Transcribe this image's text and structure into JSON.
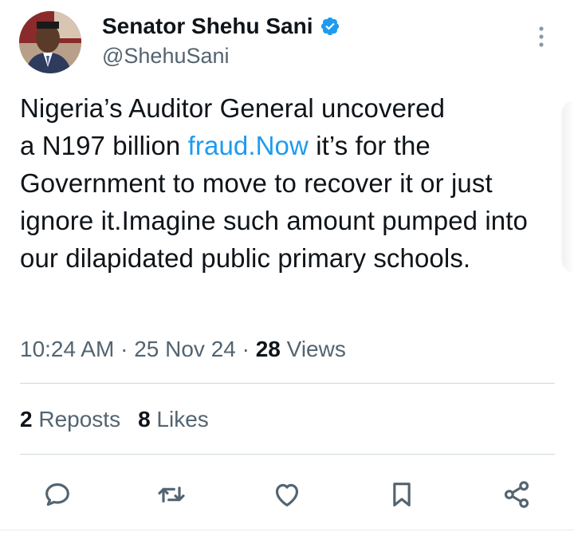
{
  "author": {
    "display_name": "Senator Shehu Sani",
    "handle": "@ShehuSani",
    "verified": true
  },
  "tweet": {
    "text_line1": "Nigeria’s Auditor General uncovered",
    "text_line2_pre": "a N197 billion ",
    "text_link": "fraud.Now",
    "text_line2_post": " it’s for the",
    "text_rest": "Government to move to recover it or just ignore it.Imagine such amount pumped into our dilapidated public primary schools."
  },
  "meta": {
    "time": "10:24 AM",
    "sep1": " · ",
    "date": "25 Nov 24",
    "sep2": " · ",
    "views_count": "28",
    "views_label": " Views"
  },
  "stats": {
    "reposts_count": "2",
    "reposts_label": " Reposts",
    "likes_count": "8",
    "likes_label": " Likes"
  },
  "icons": {
    "more": "more-vertical-icon",
    "verified": "verified-badge-icon",
    "reply": "reply-icon",
    "repost": "repost-icon",
    "like": "heart-icon",
    "bookmark": "bookmark-icon",
    "share": "share-icon"
  },
  "colors": {
    "text": "#0f1419",
    "secondary": "#536471",
    "link": "#1d9bf0",
    "verified": "#1d9bf0",
    "divider": "#cfd9de"
  }
}
